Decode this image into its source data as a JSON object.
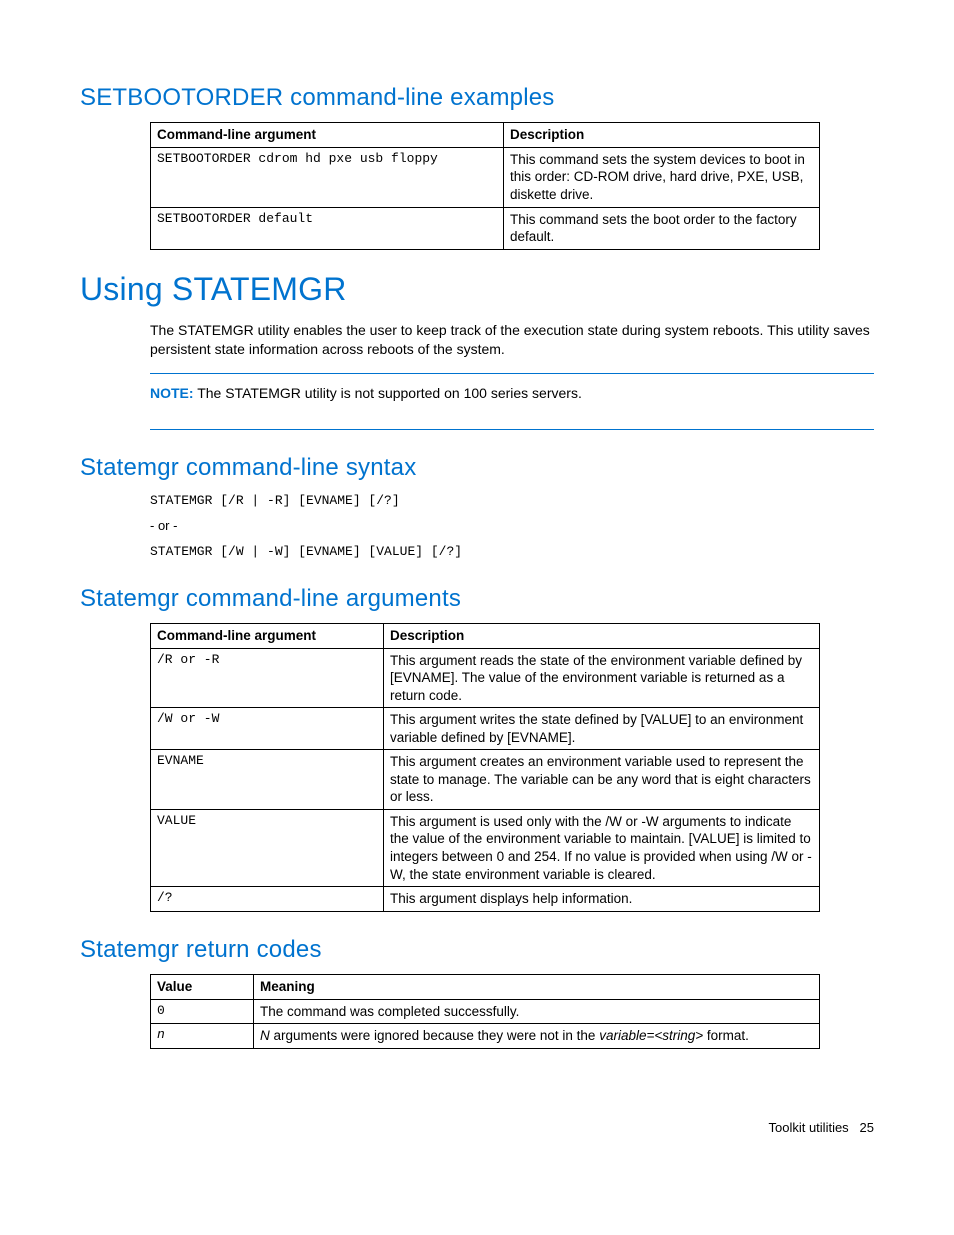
{
  "sections": {
    "setbootorder_examples": {
      "heading": "SETBOOTORDER command-line examples",
      "headers": [
        "Command-line argument",
        "Description"
      ],
      "rows": [
        {
          "arg": "SETBOOTORDER cdrom hd pxe usb floppy",
          "desc": "This command sets the system devices to boot in this order: CD-ROM drive, hard drive, PXE, USB, diskette drive."
        },
        {
          "arg": "SETBOOTORDER default",
          "desc": "This command sets the boot order to the factory default."
        }
      ]
    },
    "using_statemgr": {
      "heading": "Using STATEMGR",
      "paragraph": "The STATEMGR utility enables the user to keep track of the execution state during system reboots. This utility saves persistent state information across reboots of the system.",
      "note_label": "NOTE:",
      "note_text": "The STATEMGR utility is not supported on 100 series servers."
    },
    "syntax": {
      "heading": "Statemgr command-line syntax",
      "line1": "STATEMGR [/R | -R] [EVNAME] [/?]",
      "or": "- or -",
      "line2": "STATEMGR [/W | -W] [EVNAME] [VALUE] [/?]"
    },
    "arguments": {
      "heading": "Statemgr command-line arguments",
      "headers": [
        "Command-line argument",
        "Description"
      ],
      "rows": [
        {
          "arg": "/R or -R",
          "desc": "This argument reads the state of the environment variable defined by [EVNAME]. The value of the environment variable is returned as a return code."
        },
        {
          "arg": "/W or -W",
          "desc": "This argument writes the state defined by [VALUE] to an environment variable defined by [EVNAME]."
        },
        {
          "arg": "EVNAME",
          "desc": "This argument creates an environment variable used to represent the state to manage. The variable can be any word that is eight characters or less."
        },
        {
          "arg": "VALUE",
          "desc": "This argument is used only with the /W or -W arguments to indicate the value of the environment variable to maintain. [VALUE] is limited to integers between 0 and 254. If no value is provided when using /W or -W, the state environment variable is cleared."
        },
        {
          "arg": "/?",
          "desc": "This argument displays help information."
        }
      ]
    },
    "return_codes": {
      "heading": "Statemgr return codes",
      "headers": [
        "Value",
        "Meaning"
      ],
      "rows": [
        {
          "val": "0",
          "meaning_plain": "The command was completed successfully."
        },
        {
          "val_italic": "n",
          "meaning_prefix_italic": "N",
          "meaning_mid": " arguments were ignored because they were not in the ",
          "meaning_var_italic": "variable=<string>",
          "meaning_suffix": " format."
        }
      ]
    }
  },
  "footer": {
    "label": "Toolkit utilities",
    "page": "25"
  }
}
